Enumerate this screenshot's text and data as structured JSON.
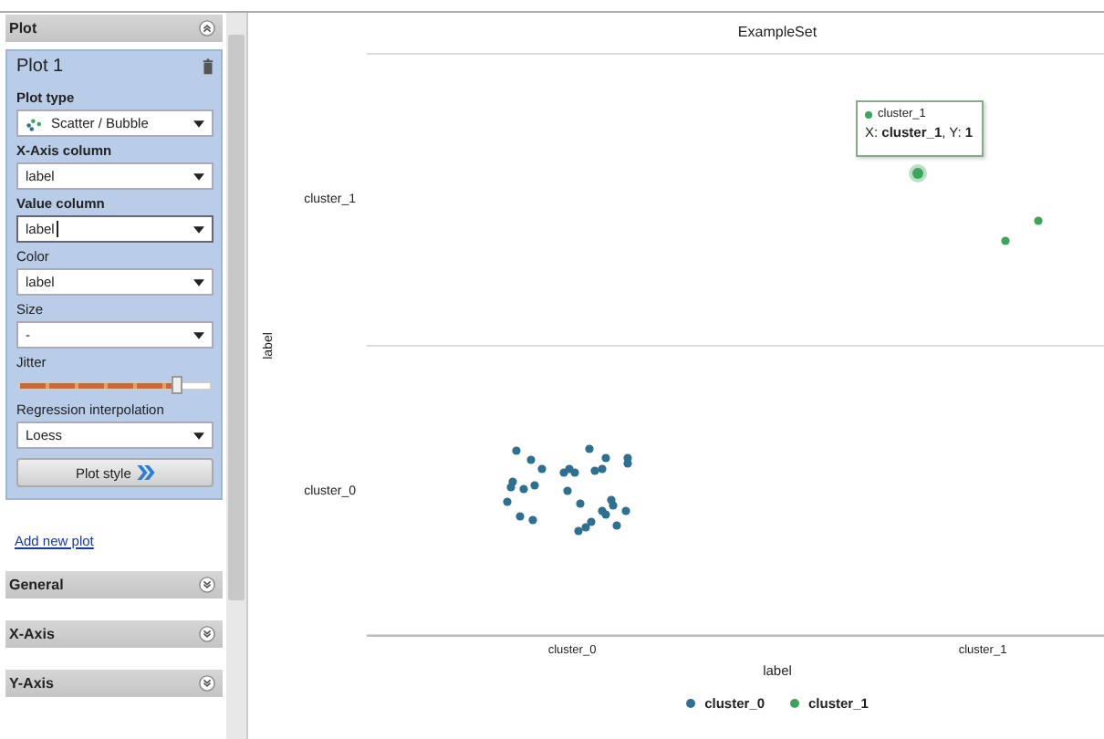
{
  "panel": {
    "header": {
      "title": "Plot",
      "expanded": true
    },
    "plot": {
      "title": "Plot 1",
      "fields": [
        {
          "kind": "dropdown",
          "label": "Plot type",
          "required": true,
          "value": "Scatter / Bubble",
          "focused": false
        },
        {
          "kind": "dropdown",
          "label": "X-Axis column",
          "required": true,
          "value": "label",
          "focused": false
        },
        {
          "kind": "dropdown",
          "label": "Value column",
          "required": true,
          "value": "label",
          "focused": true
        },
        {
          "kind": "dropdown",
          "label": "Color",
          "required": false,
          "value": "label",
          "focused": false
        },
        {
          "kind": "dropdown",
          "label": "Size",
          "required": false,
          "value": "-",
          "focused": false
        },
        {
          "kind": "slider",
          "label": "Jitter",
          "required": false,
          "level": 0.82
        },
        {
          "kind": "dropdown",
          "label": "Regression interpolation",
          "required": false,
          "value": "Loess",
          "focused": false
        }
      ],
      "style_button": "Plot style"
    },
    "add_link": "Add new plot",
    "sections": [
      {
        "title": "General",
        "expanded": false
      },
      {
        "title": "X-Axis",
        "expanded": false
      },
      {
        "title": "Y-Axis",
        "expanded": false
      }
    ]
  },
  "chart": {
    "title": "ExampleSet",
    "y_axis_label": "label",
    "y_ticks": [
      "cluster_1",
      "cluster_0"
    ],
    "x_ticks": [
      "cluster_0",
      "cluster_1"
    ],
    "x_axis_label": "label",
    "tooltip": {
      "series": "cluster_1",
      "text": "X: **cluster_1**, Y: **1**"
    },
    "legend": [
      {
        "label": "cluster_0",
        "color": "#2f6f8f"
      },
      {
        "label": "cluster_1",
        "color": "#3da35d"
      }
    ]
  }
}
